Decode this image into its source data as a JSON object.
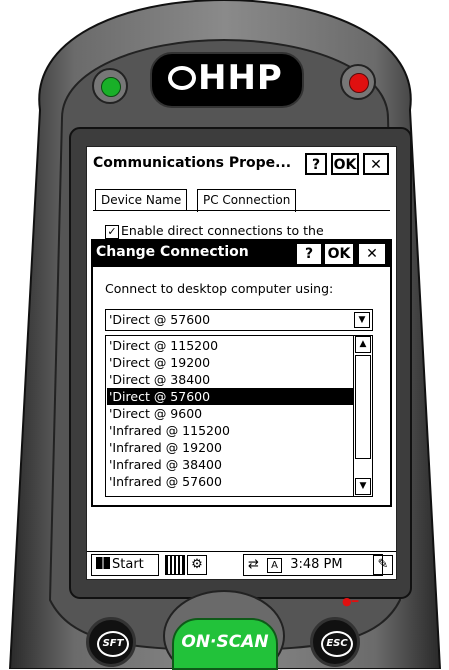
{
  "device": {
    "brand": "HHP",
    "keys": {
      "sft": "SFT",
      "scan": "ON·SCAN",
      "esc": "ESC"
    },
    "colors": {
      "led_left": "#19b028",
      "led_right": "#e01010",
      "scan_key": "#22c23a"
    }
  },
  "window": {
    "title": "Communications Prope...",
    "help_label": "?",
    "ok_label": "OK",
    "close_label": "✕",
    "tabs": [
      {
        "label": "Device Name"
      },
      {
        "label": "PC Connection"
      }
    ],
    "enable_label": "Enable direct connections to the"
  },
  "dialog": {
    "title": "Change Connection",
    "help_label": "?",
    "ok_label": "OK",
    "close_label": "✕",
    "prompt": "Connect to desktop computer using:",
    "selected_value": "'Direct @ 57600",
    "options": [
      "'Direct @ 115200",
      "'Direct @ 19200",
      "'Direct @ 38400",
      "'Direct @ 57600",
      "'Direct @ 9600",
      "'Infrared @ 115200",
      "'Infrared @ 19200",
      "'Infrared @ 38400",
      "'Infrared @ 57600"
    ],
    "selected_index": 3
  },
  "taskbar": {
    "start_label": "Start",
    "clock": "3:48 PM",
    "input_indicator": "A"
  }
}
